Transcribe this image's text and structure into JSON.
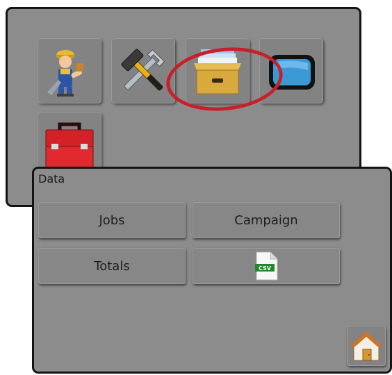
{
  "main_menu": {
    "tiles": [
      {
        "icon": "worker-icon"
      },
      {
        "icon": "tools-icon"
      },
      {
        "icon": "file-drawer-icon",
        "highlighted": true
      },
      {
        "icon": "display-icon"
      },
      {
        "icon": "toolbox-icon"
      }
    ],
    "highlight_color": "#c8202b"
  },
  "data_panel": {
    "title": "Data",
    "buttons": {
      "jobs": "Jobs",
      "campaign": "Campaign",
      "totals": "Totals",
      "csv_icon_text": "CSV"
    },
    "home_icon": "home-icon"
  },
  "colors": {
    "panel_bg": "#8c8c8c",
    "panel_border": "#141414",
    "csv_badge": "#1d8a2c"
  }
}
